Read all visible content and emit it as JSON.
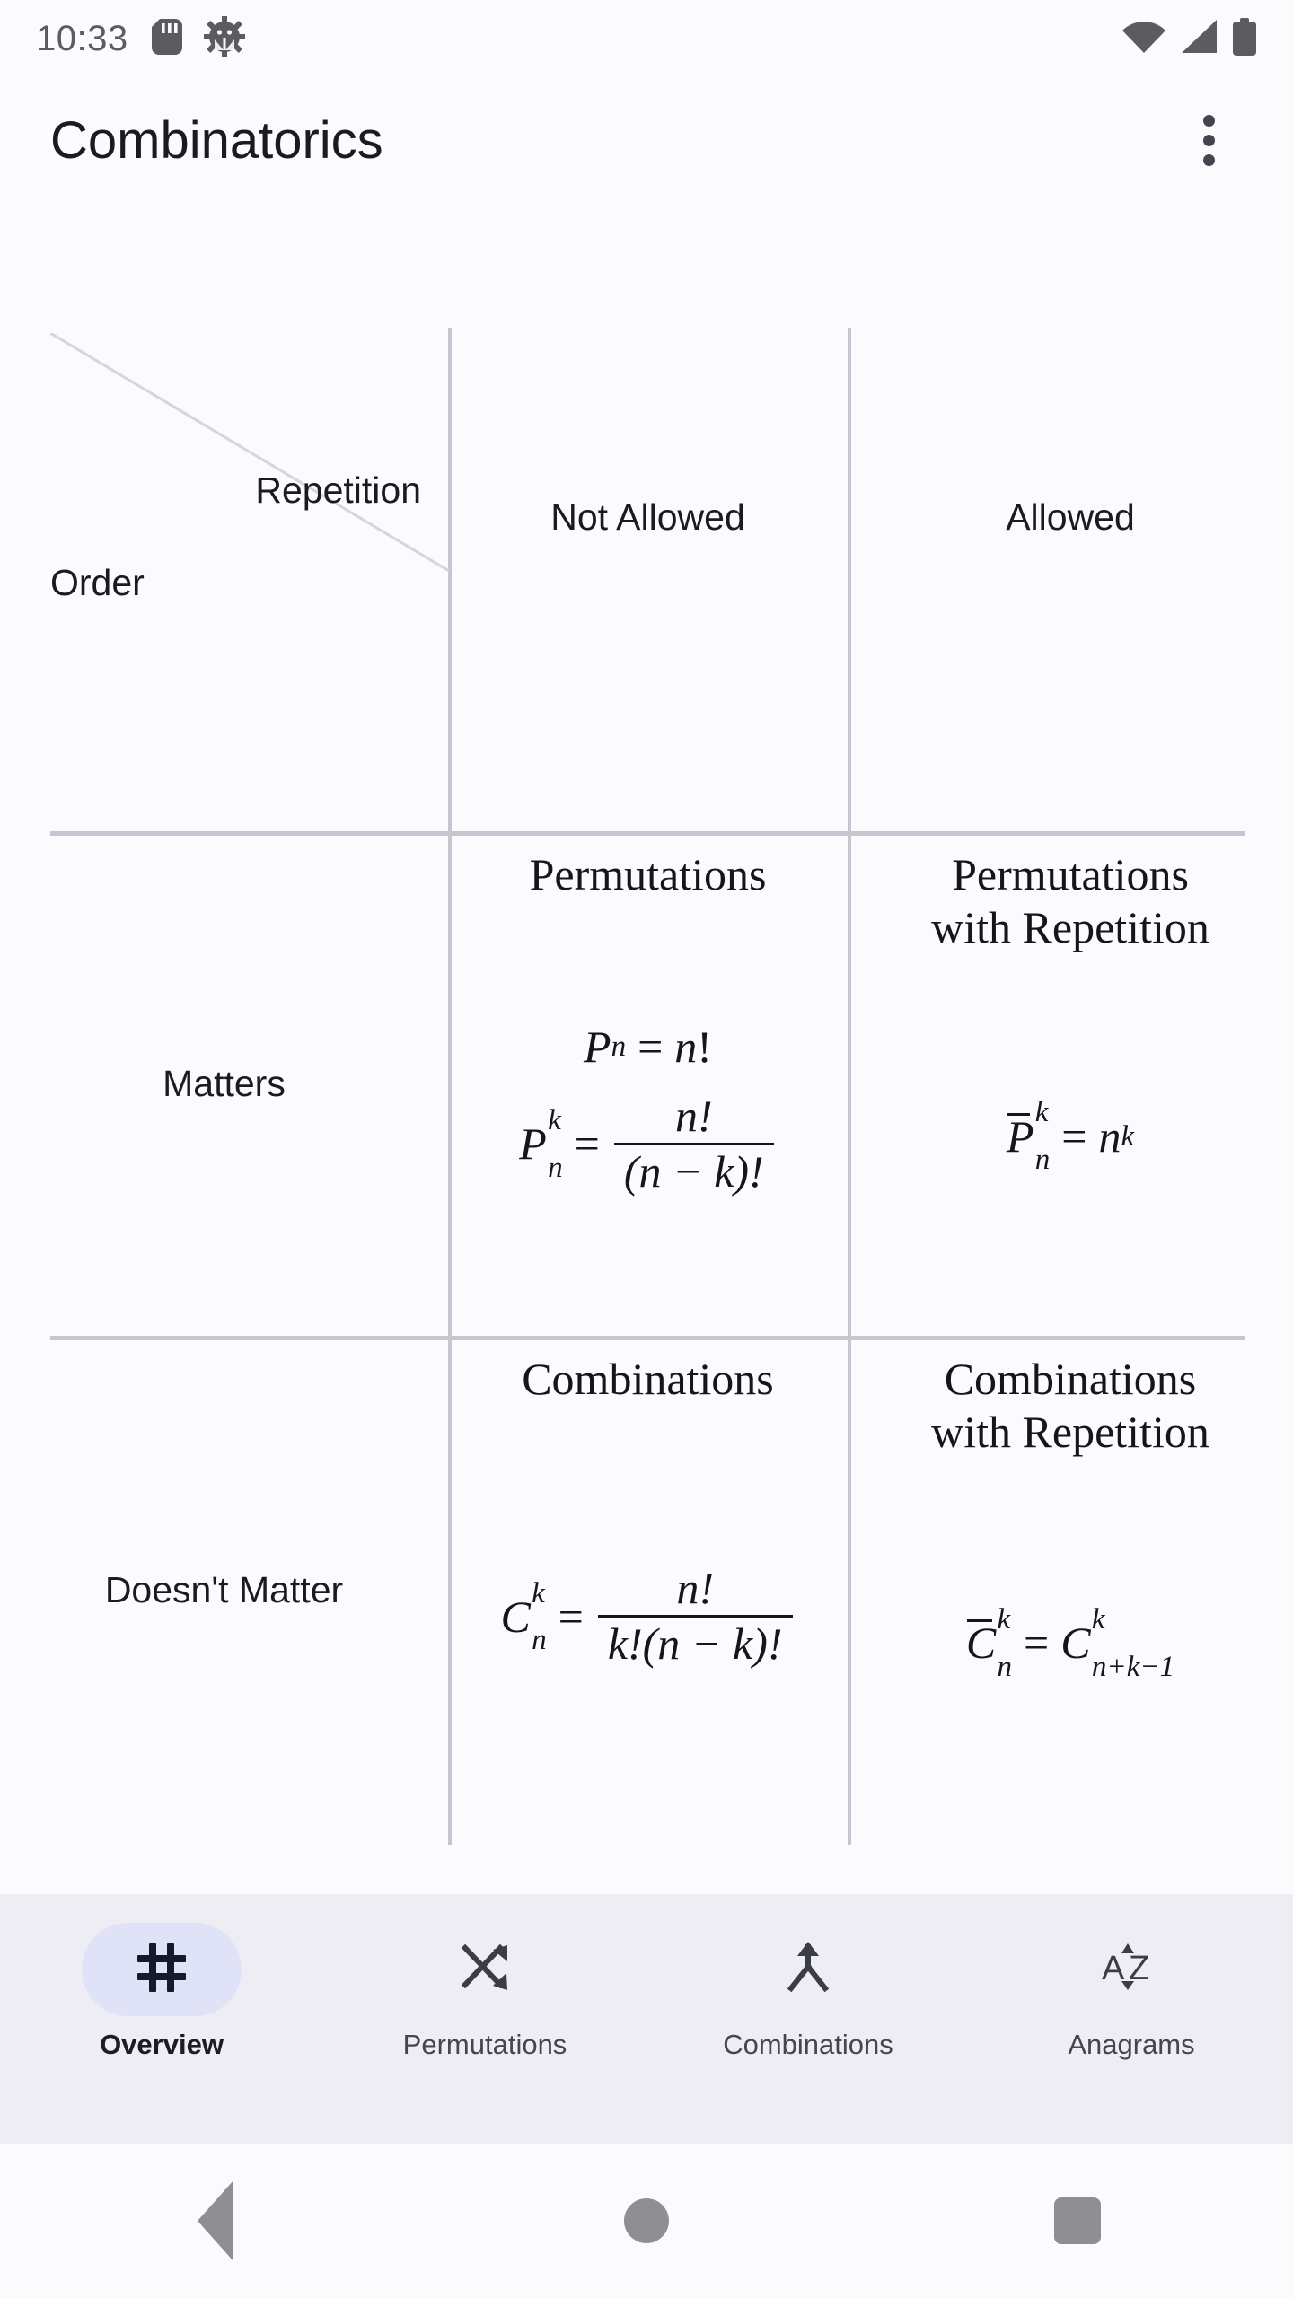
{
  "status_bar": {
    "clock": "10:33",
    "left_icons": [
      "sd-card-icon",
      "android-debug-gear-icon"
    ],
    "right_icons": [
      "wifi-icon",
      "cellular-signal-icon",
      "battery-icon"
    ]
  },
  "app_bar": {
    "title": "Combinatorics",
    "overflow_menu": "more-options-icon"
  },
  "table": {
    "corner": {
      "column_axis_label": "Repetition",
      "row_axis_label": "Order"
    },
    "column_headers": [
      "Not Allowed",
      "Allowed"
    ],
    "row_headers": [
      "Matters",
      "Doesn't Matter"
    ],
    "cells": {
      "matters_not_allowed": {
        "title": "Permutations",
        "formula1": {
          "base": "P",
          "sub": "n",
          "rhs_n": "n",
          "rhs_bang": "!"
        },
        "formula2": {
          "base": "P",
          "sup": "k",
          "sub": "n",
          "num": "n!",
          "den": "(n − k)!"
        }
      },
      "matters_allowed": {
        "title_line1": "Permutations",
        "title_line2": "with Repetition",
        "formula": {
          "base": "P",
          "sup": "k",
          "sub": "n",
          "rhs_base": "n",
          "rhs_sup": "k"
        }
      },
      "doesnt_matter_not_allowed": {
        "title": "Combinations",
        "formula": {
          "base": "C",
          "sup": "k",
          "sub": "n",
          "num": "n!",
          "den": "k!(n − k)!"
        }
      },
      "doesnt_matter_allowed": {
        "title_line1": "Combinations",
        "title_line2": "with Repetition",
        "formula": {
          "base": "C",
          "sup": "k",
          "sub": "n",
          "rhs_base": "C",
          "rhs_sup": "k",
          "rhs_sub": "n+k−1"
        }
      }
    }
  },
  "bottom_nav": {
    "selected": "Overview",
    "items": [
      {
        "label": "Overview",
        "icon": "hash-grid-icon",
        "selected": true
      },
      {
        "label": "Permutations",
        "icon": "shuffle-icon",
        "selected": false
      },
      {
        "label": "Combinations",
        "icon": "call-merge-icon",
        "selected": false
      },
      {
        "label": "Anagrams",
        "icon": "sort-az-icon",
        "selected": false
      }
    ]
  },
  "system_nav": {
    "back": "back-triangle-icon",
    "home": "home-circle-icon",
    "recents": "recents-square-icon"
  },
  "colors": {
    "background": "#FBFAFD",
    "grid_line": "#C7C5CF",
    "nav_background": "#EEEDF4",
    "nav_selected_pill": "#E0E2F8",
    "text_primary": "#1B1B1F",
    "status_icon": "#5B5B60"
  }
}
